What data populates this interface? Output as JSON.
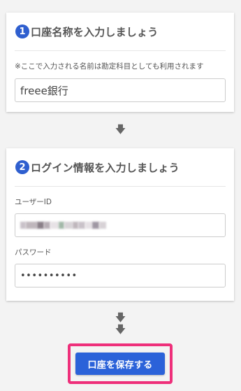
{
  "step1": {
    "number": "1",
    "title": "口座名称を入力しましょう",
    "note": "※ここで入力される名前は勘定科目としても利用されます",
    "account_name_value": "freee銀行"
  },
  "step2": {
    "number": "2",
    "title": "ログイン情報を入力しましょう",
    "userid_label": "ユーザーID",
    "password_label": "パスワード",
    "password_value": "••••••••••"
  },
  "arrows": {
    "down": "🡇"
  },
  "save_button_label": "口座を保存する",
  "colors": {
    "badge": "#2f5fcf",
    "button": "#2b62d9",
    "highlight": "#ee2f7a"
  }
}
